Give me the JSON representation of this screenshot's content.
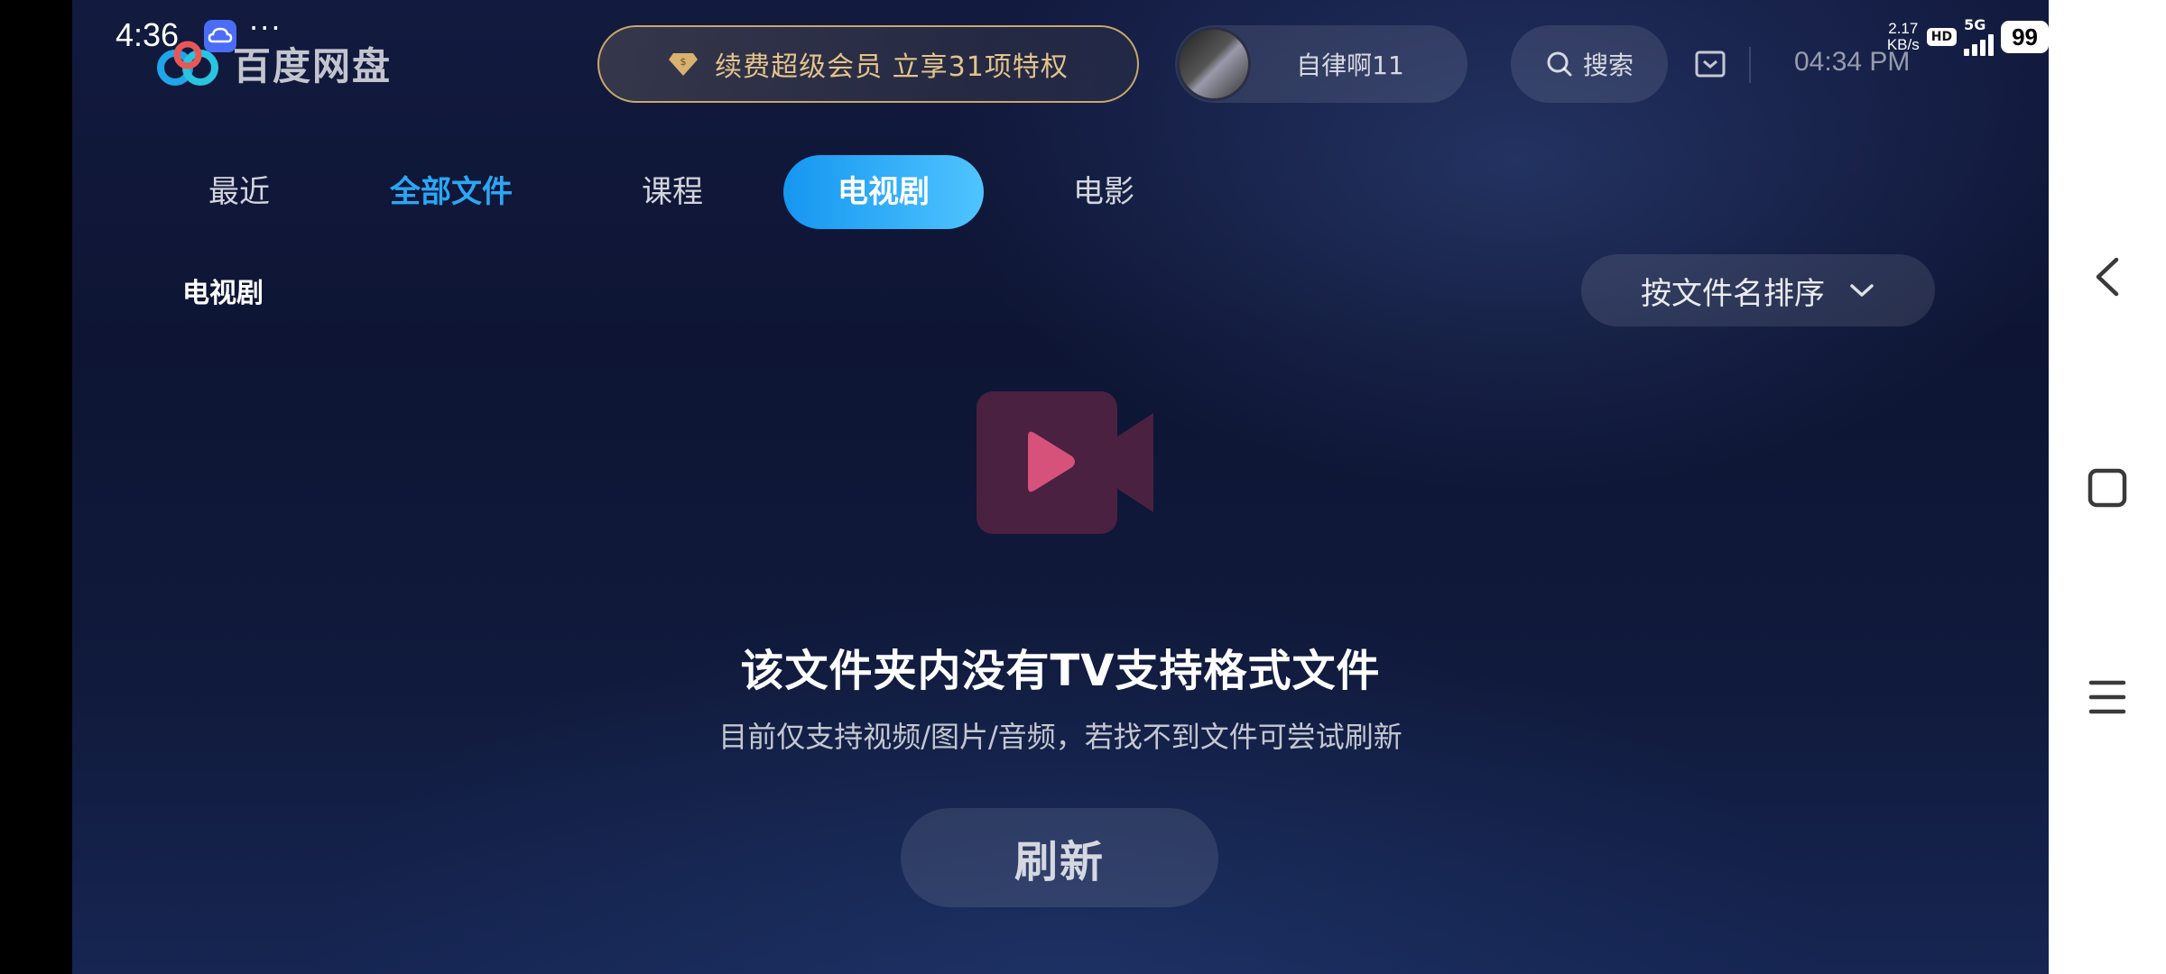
{
  "status_bar": {
    "time": "4:36",
    "more": "···",
    "net_speed_value": "2.17",
    "net_speed_unit": "KB/s",
    "hd": "HD",
    "network": "5G",
    "battery": "99"
  },
  "header": {
    "app_name": "百度网盘",
    "vip_promo": "续费超级会员 立享31项特权",
    "user_name": "自律啊11",
    "search_label": "搜索",
    "clock": "04:34 PM"
  },
  "tabs": [
    {
      "label": "最近"
    },
    {
      "label": "全部文件"
    },
    {
      "label": "课程"
    },
    {
      "label": "电视剧"
    },
    {
      "label": "电影"
    }
  ],
  "section": {
    "title": "电视剧",
    "sort_label": "按文件名排序"
  },
  "empty_state": {
    "title": "该文件夹内没有TV支持格式文件",
    "subtitle": "目前仅支持视频/图片/音频，若找不到文件可尝试刷新",
    "refresh_label": "刷新"
  },
  "colors": {
    "accent": "#1596f0",
    "vip_gold": "#e4c38b",
    "empty_icon": "#d6527a"
  }
}
